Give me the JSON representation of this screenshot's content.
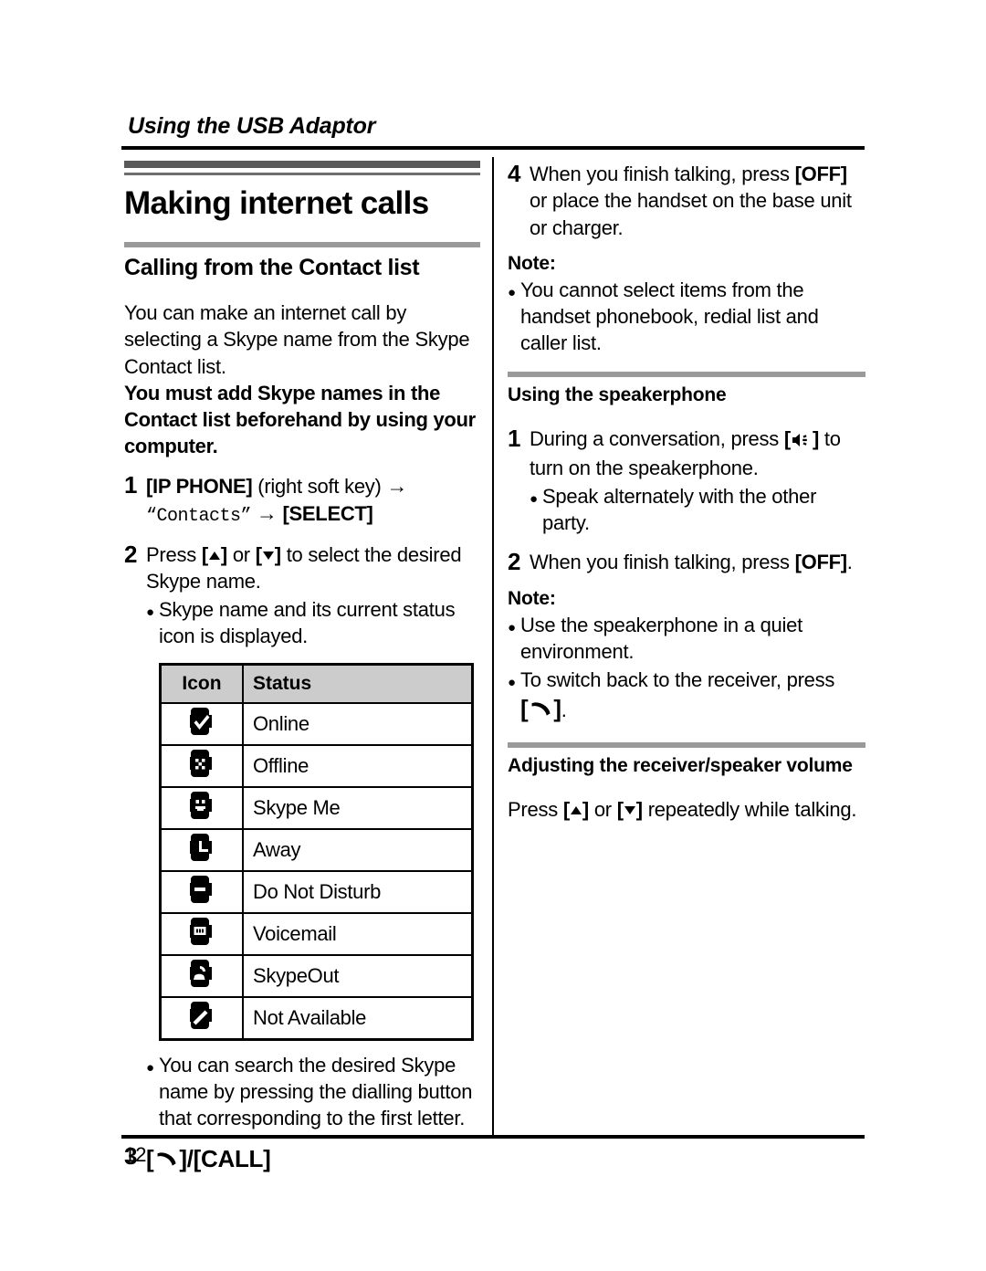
{
  "running_head": "Using the USB Adaptor",
  "page_number": "12",
  "left_column": {
    "chapter_title": "Making internet calls",
    "section_title": "Calling from the Contact list",
    "intro_paragraph": "You can make an internet call by selecting a Skype name from the Skype Contact list.",
    "intro_bold_paragraph": "You must add Skype names in the Contact list beforehand by using your computer.",
    "step1": {
      "number": "1",
      "key_ip_phone": "[IP PHONE]",
      "soft_key_note": "(right soft key)",
      "arrow": "→",
      "contacts_quoted": "“Contacts”",
      "key_select": "[SELECT]"
    },
    "step2": {
      "number": "2",
      "press_label": "Press",
      "key_up": "[▲]",
      "or_label": "or",
      "key_down": "[▼]",
      "text_tail": "to select the desired Skype name.",
      "bullet": "Skype name and its current status icon is displayed."
    },
    "status_table": {
      "headers": [
        "Icon",
        "Status"
      ],
      "rows": [
        {
          "icon": "skype-status-online-icon",
          "status": "Online"
        },
        {
          "icon": "skype-status-offline-icon",
          "status": "Offline"
        },
        {
          "icon": "skype-status-skype-me-icon",
          "status": "Skype Me"
        },
        {
          "icon": "skype-status-away-icon",
          "status": "Away"
        },
        {
          "icon": "skype-status-do-not-disturb-icon",
          "status": "Do Not Disturb"
        },
        {
          "icon": "skype-status-voicemail-icon",
          "status": "Voicemail"
        },
        {
          "icon": "skype-status-skypeout-icon",
          "status": "SkypeOut"
        },
        {
          "icon": "skype-status-not-available-icon",
          "status": "Not Available"
        }
      ]
    },
    "search_bullet": "You can search the desired Skype name by pressing the dialling button that corresponding to the first letter.",
    "step3": {
      "number": "3",
      "key_handset": "[✆]",
      "separator": "/",
      "key_call": "[CALL]"
    }
  },
  "right_column": {
    "step4": {
      "number": "4",
      "text_head": "When you finish talking, press",
      "key_off": "[OFF]",
      "text_tail": "or place the handset on the base unit or charger."
    },
    "note1_label": "Note:",
    "note1_bullet": "You cannot select items from the handset phonebook, redial list and caller list.",
    "speakerphone_title": "Using the speakerphone",
    "step1": {
      "number": "1",
      "text_head": "During a conversation, press",
      "key_speaker": "[🔊]",
      "text_tail": "to turn on the speakerphone.",
      "bullet": "Speak alternately with the other party."
    },
    "step2": {
      "number": "2",
      "text_head": "When you finish talking, press",
      "key_off": "[OFF]",
      "period": "."
    },
    "note2_label": "Note:",
    "note2_bullets": [
      "Use the speakerphone in a quiet environment.",
      "To switch back to the receiver, press"
    ],
    "note2_key_handset": "[✆]",
    "note2_period": ".",
    "volume_title": "Adjusting the receiver/speaker volume",
    "volume_text": {
      "press_label": "Press",
      "key_up": "[▲]",
      "or_label": "or",
      "key_down": "[▼]",
      "tail": "repeatedly while talking."
    }
  },
  "colors": {
    "chapter_rule": "#595959",
    "section_rule": "#9a9a9a",
    "table_header_bg": "#cccccc",
    "text": "#000000"
  }
}
